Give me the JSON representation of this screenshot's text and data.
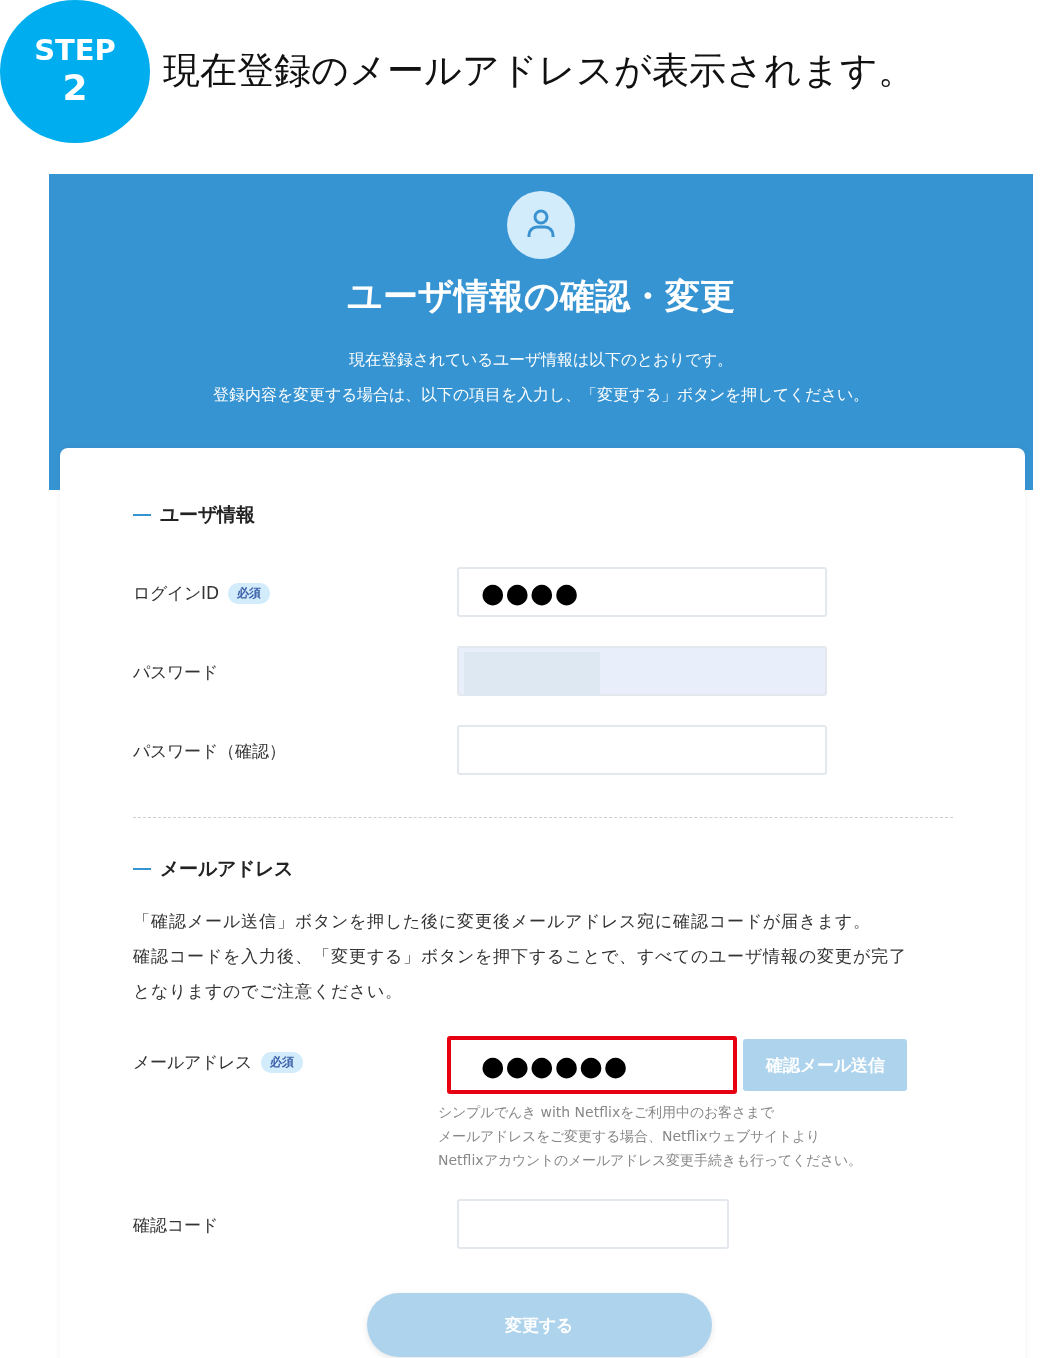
{
  "step": {
    "label": "STEP",
    "number": "2",
    "caption": "現在登録のメールアドレスが表示されます。"
  },
  "header": {
    "title": "ユーザ情報の確認・変更",
    "description": [
      "現在登録されているユーザ情報は以下のとおりです。",
      "登録内容を変更する場合は、以下の項目を入力し、「変更する」ボタンを押してください。"
    ]
  },
  "sections": [
    {
      "heading": "ユーザ情報",
      "fields": [
        {
          "label": "ログインID",
          "badge": "必須",
          "value": "●●●●",
          "disabled": false,
          "highlighted": false
        },
        {
          "label": "パスワード",
          "disabled": true,
          "highlighted": false
        },
        {
          "label": "パスワード（確認）",
          "disabled": false,
          "highlighted": false
        }
      ]
    },
    {
      "heading": "メールアドレス",
      "paragraph": [
        "「確認メール送信」ボタンを押した後に変更後メールアドレス宛に確認コードが届きます。",
        "確認コードを入力後、「変更する」ボタンを押下することで、すべてのユーザ情報の変更が完了となりますのでご注意ください。"
      ],
      "fields": [
        {
          "label": "メールアドレス",
          "badge": "必須",
          "value": "●●●●●●",
          "disabled": false,
          "highlighted": true,
          "button": {
            "label": "確認メール送信",
            "disabled": true
          },
          "note": [
            "シンプルでんき with Netflixをご利用中のお客さまで",
            "メールアドレスをご変更する場合、Netflixウェブサイトより",
            "Netflixアカウントのメールアドレス変更手続きも行ってください。"
          ]
        },
        {
          "label": "確認コード",
          "disabled": false,
          "highlighted": false,
          "short": true
        }
      ]
    }
  ],
  "submit": {
    "label": "変更する",
    "disabled": true
  }
}
